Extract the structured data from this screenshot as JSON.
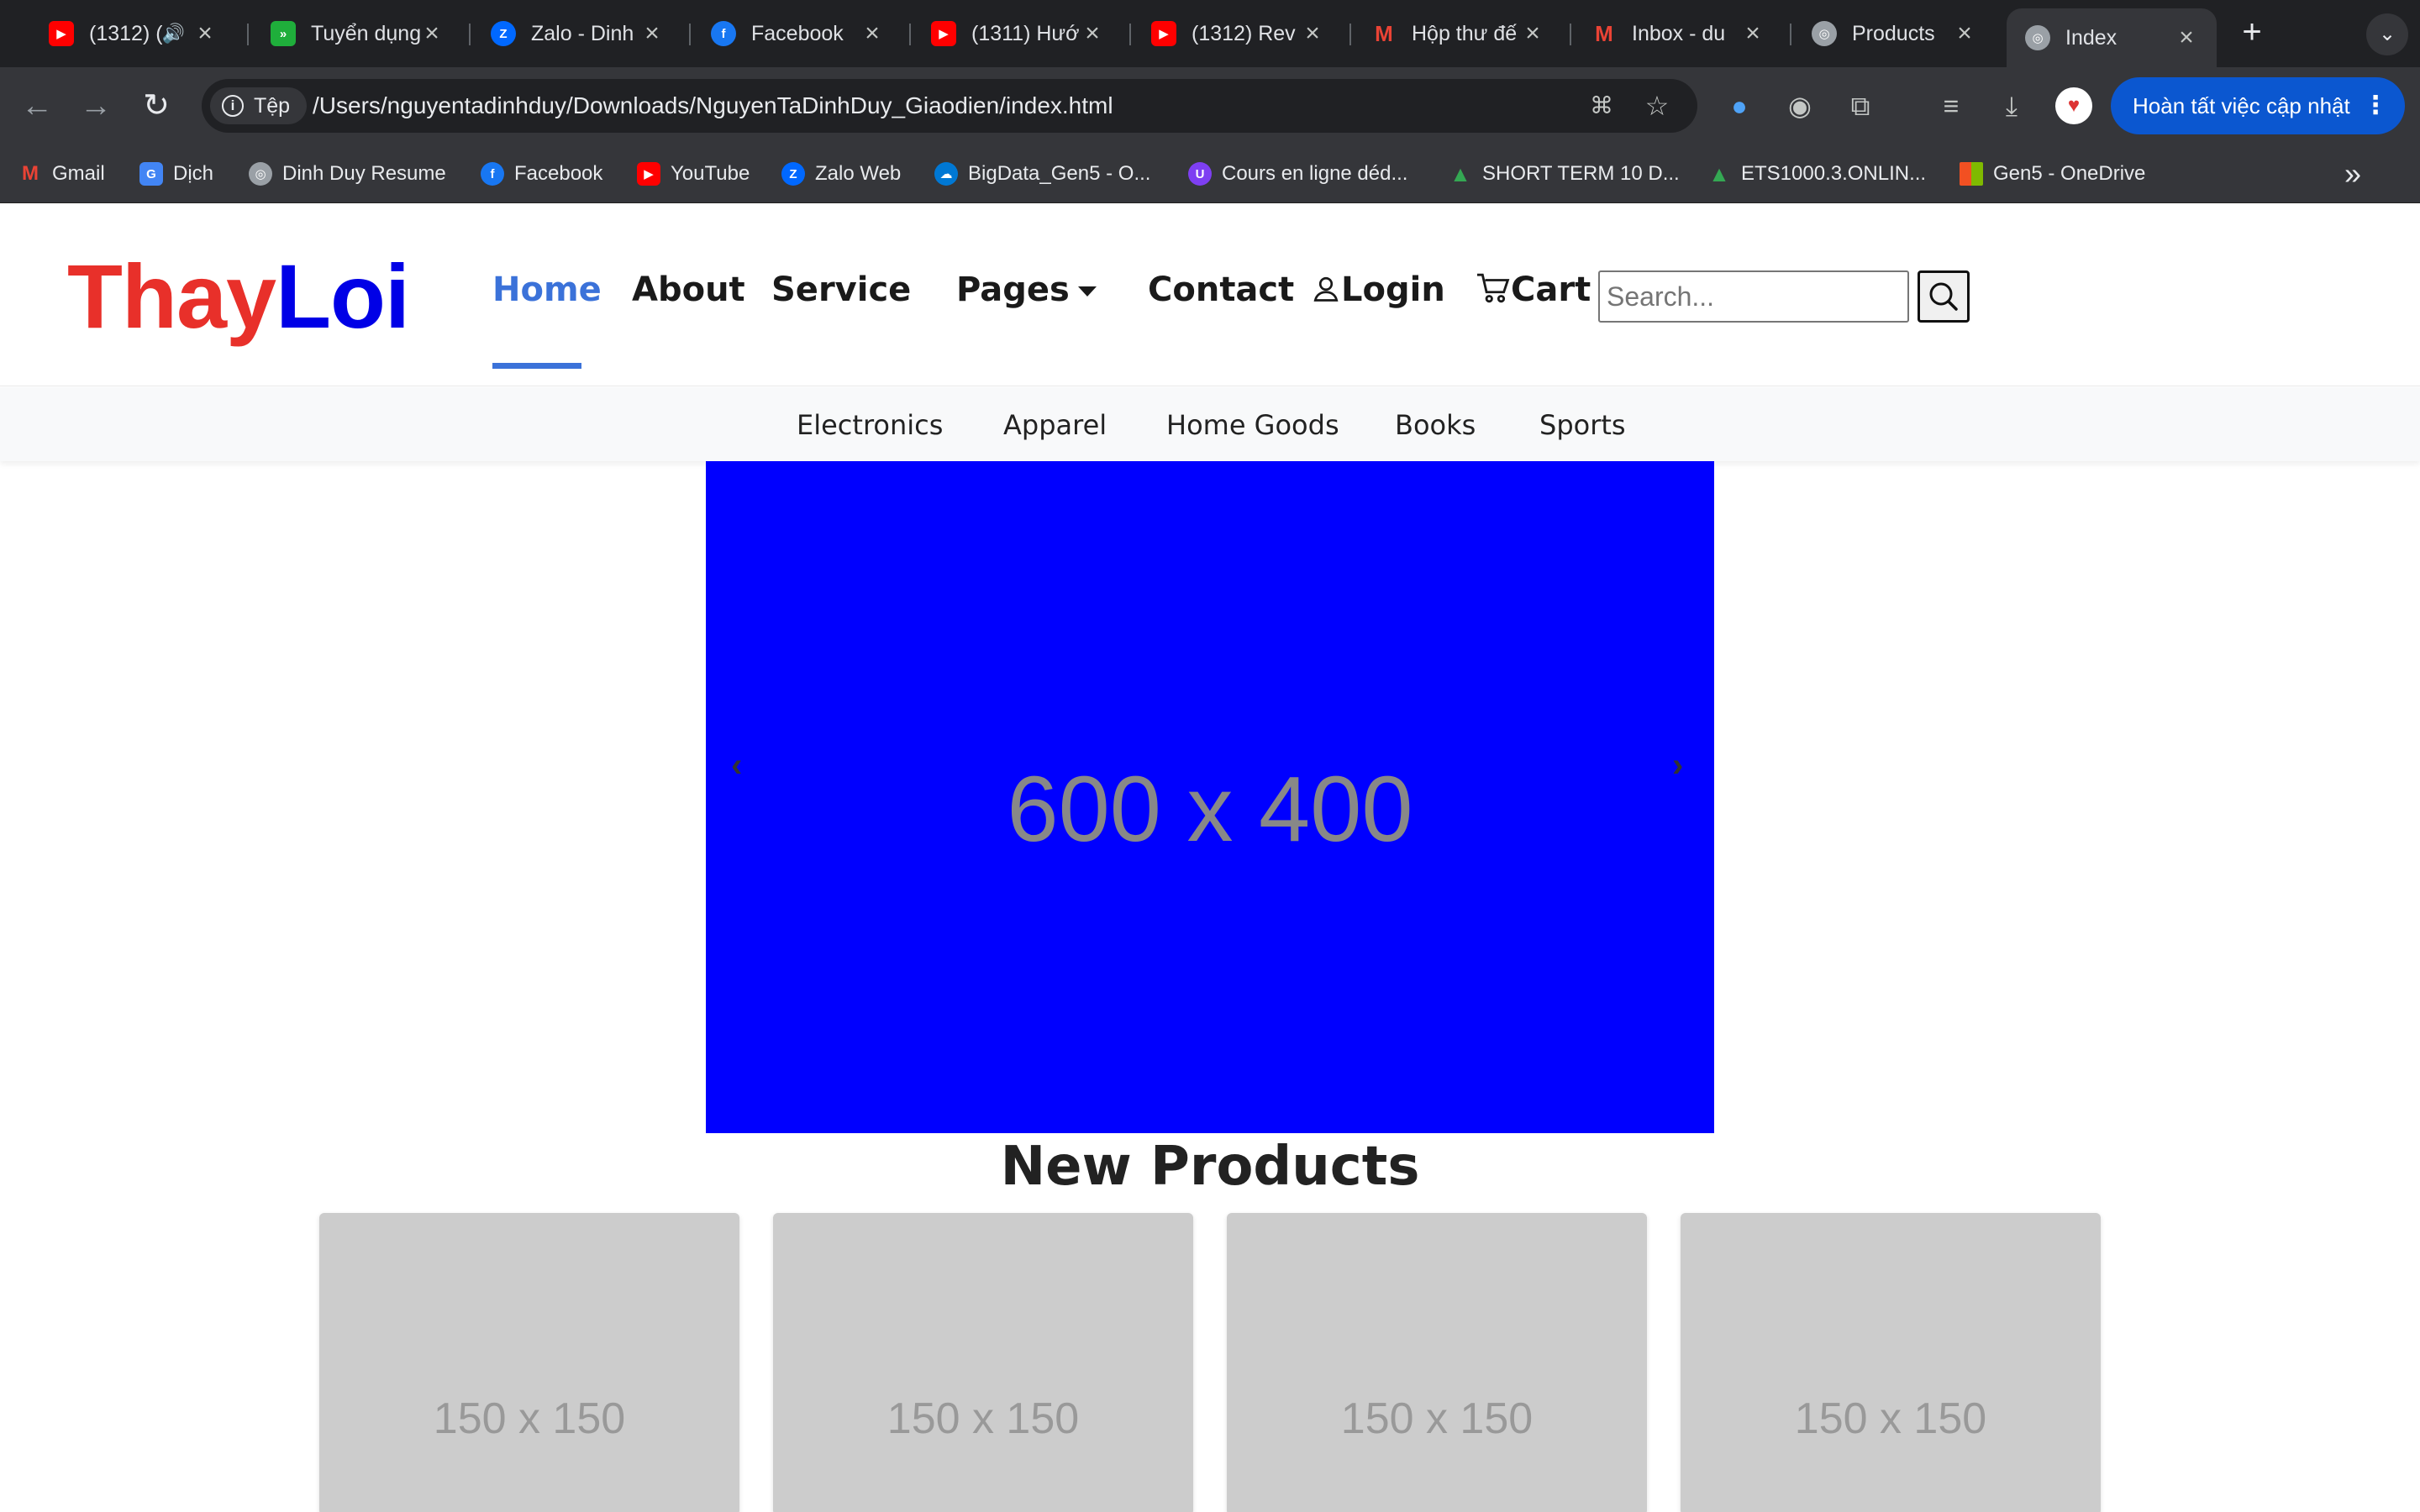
{
  "browser": {
    "tabs": [
      {
        "title": "(1312) (",
        "icon": "youtube-icon",
        "color": "#ff0000"
      },
      {
        "title": "Tuyển dụng",
        "icon": "tuyendung-icon",
        "color": "#1fae3b"
      },
      {
        "title": "Zalo - Dinh",
        "icon": "zalo-icon",
        "color": "#0068ff"
      },
      {
        "title": "Facebook",
        "icon": "facebook-icon",
        "color": "#1877f2"
      },
      {
        "title": "(1311) Hướ",
        "icon": "youtube-icon",
        "color": "#ff0000"
      },
      {
        "title": "(1312) Rev",
        "icon": "youtube-icon",
        "color": "#ff0000"
      },
      {
        "title": "Hộp thư đế",
        "icon": "gmail-icon",
        "color": "#ea4335"
      },
      {
        "title": "Inbox - du",
        "icon": "gmail-icon",
        "color": "#ea4335"
      },
      {
        "title": "Products",
        "icon": "globe-icon",
        "color": "#9aa0a6"
      },
      {
        "title": "Index",
        "icon": "globe-icon",
        "color": "#9aa0a6"
      }
    ],
    "address": {
      "chip_label": "Tệp",
      "url": "/Users/nguyentadinhduy/Downloads/NguyenTaDinhDuy_Giaodien/index.html"
    },
    "update_button": "Hoàn tất việc cập nhật",
    "bookmarks": [
      {
        "label": "Gmail",
        "color": "#ea4335"
      },
      {
        "label": "Dịch",
        "color": "#4285f4"
      },
      {
        "label": "Dinh Duy Resume",
        "color": "#9aa0a6"
      },
      {
        "label": "Facebook",
        "color": "#1877f2"
      },
      {
        "label": "YouTube",
        "color": "#ff0000"
      },
      {
        "label": "Zalo Web",
        "color": "#0068ff"
      },
      {
        "label": "BigData_Gen5 - O...",
        "color": "#0078d4"
      },
      {
        "label": "Cours en ligne déd...",
        "color": "#7e3ff2"
      },
      {
        "label": "SHORT TERM 10 D...",
        "color": "#34a853"
      },
      {
        "label": "ETS1000.3.ONLIN...",
        "color": "#34a853"
      },
      {
        "label": "Gen5 - OneDrive",
        "color": "#f25022"
      }
    ]
  },
  "site": {
    "logo_part1": "Thay",
    "logo_part2": "Loi",
    "nav": {
      "home": "Home",
      "about": "About",
      "service": "Service",
      "pages": "Pages",
      "contact": "Contact",
      "login": "Login",
      "cart": "Cart"
    },
    "search_placeholder": "Search...",
    "categories": [
      "Electronics",
      "Apparel",
      "Home Goods",
      "Books",
      "Sports"
    ],
    "slider": {
      "placeholder_text": "600 x 400",
      "prev": "‹",
      "next": "›"
    },
    "new_products_title": "New Products",
    "products": [
      {
        "image_text": "150 x 150"
      },
      {
        "image_text": "150 x 150"
      },
      {
        "image_text": "150 x 150"
      },
      {
        "image_text": "150 x 150"
      }
    ]
  }
}
